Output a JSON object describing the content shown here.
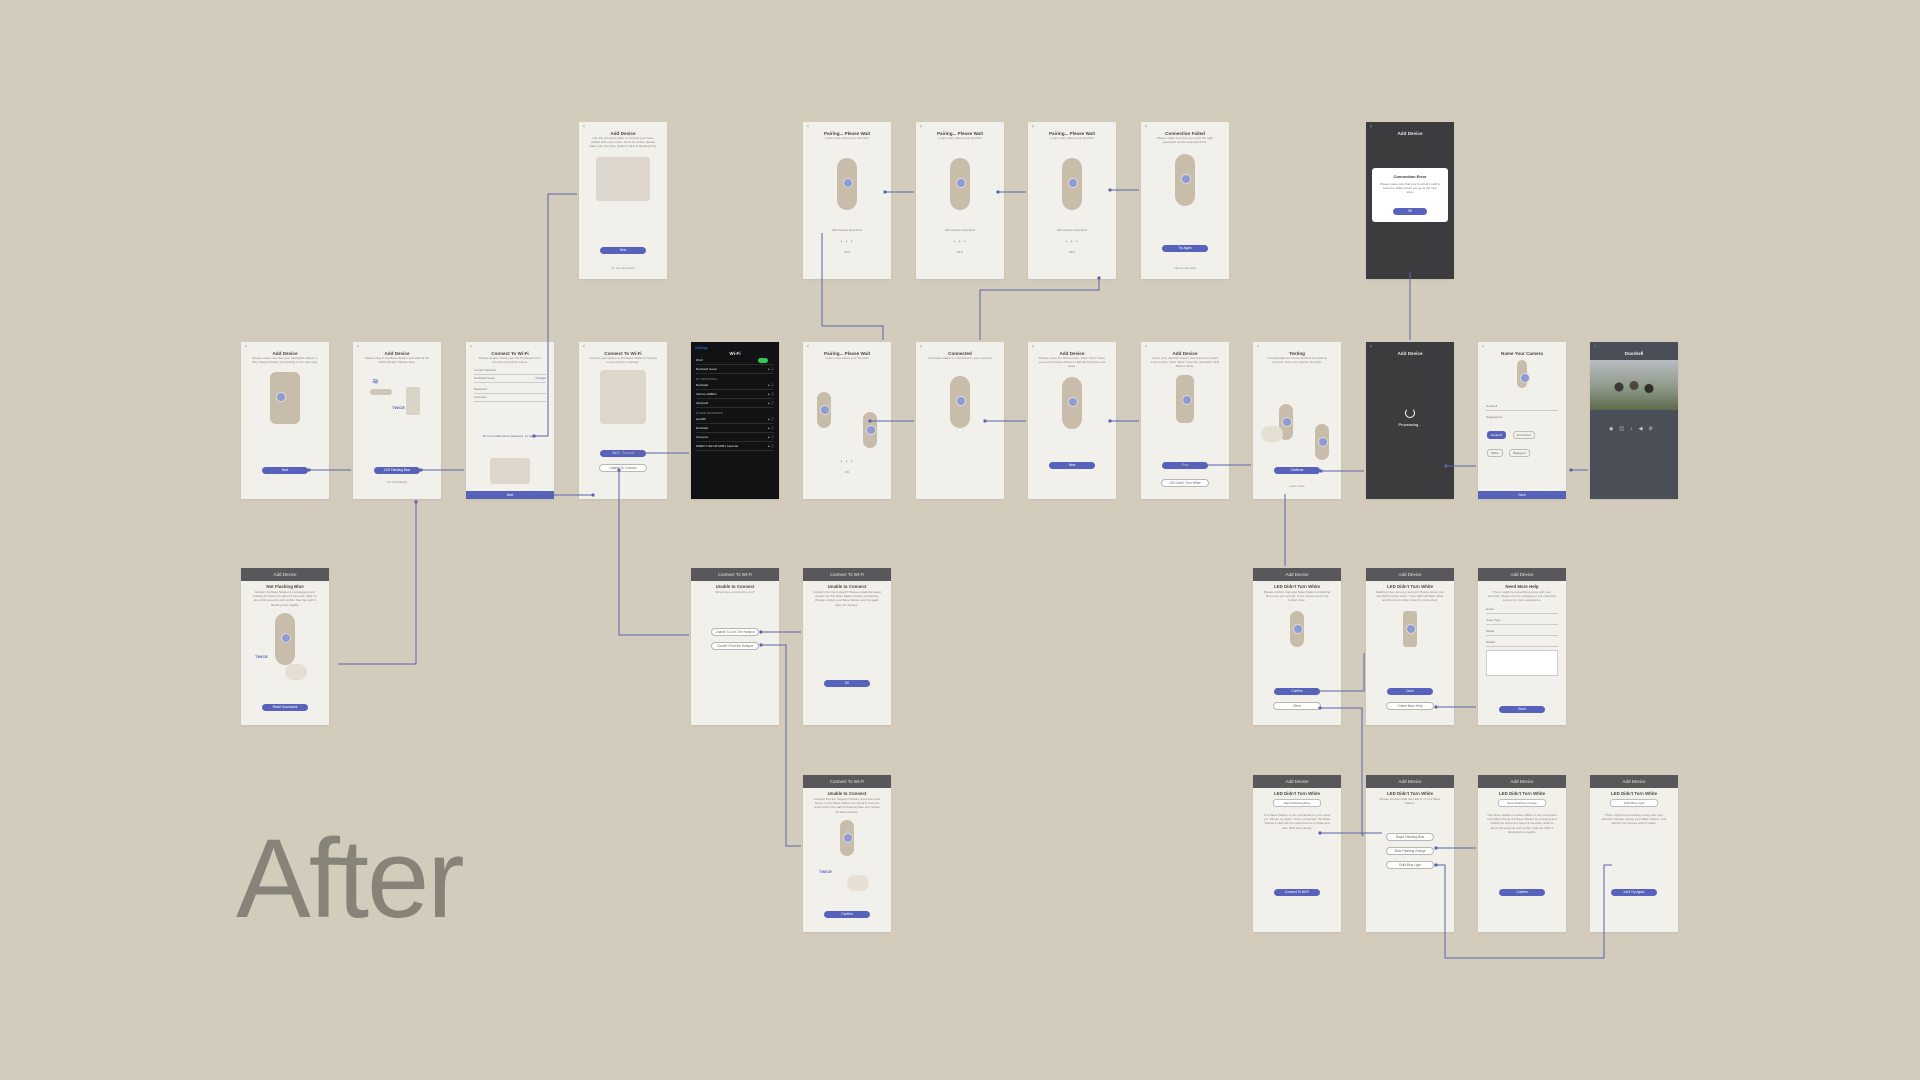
{
  "title": "After",
  "screens": {
    "s_adddevice_top": {
      "title": "Add Device",
      "body": "Use the provided cable to connect your base station with your router. Once it's ready, please make sure the base station's LED is flashing blue.",
      "button": "Next",
      "link": "I'm not connected"
    },
    "s_pair1": {
      "title": "Pairing... Please Wait",
      "body": "Learn more about your doorbell",
      "status": "LED flashes blue/white",
      "pct": "33%"
    },
    "s_pair2": {
      "title": "Pairing... Please Wait",
      "body": "Learn more about your doorbell",
      "status": "LED flashes blue/white",
      "pct": "66%"
    },
    "s_pair3": {
      "title": "Pairing... Please Wait",
      "body": "Learn more about your doorbell",
      "status": "LED flashes blue/white",
      "pct": "99%"
    },
    "s_connfailed": {
      "title": "Connection Failed",
      "body": "Please make sure that you input the right password for the selected Wi-Fi.",
      "button": "Try Again",
      "link": "Need more help"
    },
    "s_connerror": {
      "title": "Add Device",
      "modal_title": "Connection Error",
      "modal_body": "Please make sure that your doorbell's LED is turned to white before you go to the next step.",
      "modal_button": "OK"
    },
    "s_add1": {
      "title": "Add Device",
      "body": "Please make sure that your doorbell's battery is fully charged before proceeding to the next step.",
      "button": "Next"
    },
    "s_add2": {
      "title": "Add Device",
      "body": "Please plug in the Base Station and wait till the LED indicator flashes blue.",
      "button": "LED Flashing Blue",
      "link": "It's not flashing",
      "twice": "TWICE"
    },
    "s_wifi1": {
      "title": "Connect To Wi-Fi",
      "body": "Please double check your Wi-Fi password for smooth connection below.",
      "network_label": "Current Network",
      "network": "Rockwell Guest",
      "change": "Change",
      "password_label": "Password",
      "password": "Unknown",
      "link": "Do not enable Wi-Fi password, try again.",
      "button": "Next"
    },
    "s_wifi2": {
      "title": "Connect To Wi-Fi",
      "body": "Connect your phone to the Base Station's hotspot in your phone's settings.",
      "button": "Go To Connect",
      "button2": "Unable To Connect"
    },
    "s_settings": {
      "title": "Wi-Fi",
      "back": "Settings",
      "wifi_label": "Wi-Fi",
      "current": "Rockwell Guest",
      "section_networks": "MY NETWORKS",
      "networks": [
        "Rockwell",
        "Verizon-GIBDG",
        "xfinitywifi"
      ],
      "section_other": "OTHER NETWORKS",
      "others": [
        "eesWifi",
        "Rockwell",
        "Cameron",
        "DIRECT-4W-HP M281 LaserJet"
      ]
    },
    "s_pair4": {
      "title": "Pairing... Please Wait",
      "body": "Learn more about your doorbell",
      "pct": "0%"
    },
    "s_connected": {
      "title": "Connected",
      "body": "Your base station is connected to your network."
    },
    "s_add3": {
      "title": "Add Device",
      "body": "Please press the button once. Click \"Next\" when you see the base station's LED flashing blue and white.",
      "button": "Next"
    },
    "s_add4": {
      "title": "Add Device",
      "body": "Insert your doorbell battery and press the install button twice. Click \"Next\" once the doorbell's LED flashes white.",
      "button": "Next",
      "button2": "LED Didn't Turn White"
    },
    "s_testing": {
      "title": "Testing",
      "body": "Congratulations! You've finished the pairing process. Now, let's test the doorbell.",
      "button": "Continue",
      "link": "Learn more"
    },
    "s_processing": {
      "title": "Add Device",
      "processing": "Processing..."
    },
    "s_name": {
      "title": "Name Your Camera",
      "field": "Doorbell",
      "suggestions": "Suggestions",
      "chips": [
        "Doorbell",
        "Front Door",
        "Office",
        "Backyard"
      ],
      "button": "Save"
    },
    "s_doorbell": {
      "title": "Doorbell"
    },
    "s_notflashing": {
      "header": "Add Device",
      "title": "Not Flashing Blue",
      "body": "Restart the Base Station by unplugging and holding its button for about 5 seconds. Wait for about 30 seconds and confirm that the LED is flashing blue rapidly.",
      "twice": "TWICE",
      "button": "Reset Successful"
    },
    "s_unable1": {
      "header": "Connect To Wi-Fi",
      "title": "Unable to Connect",
      "body": "What issue occurred to you?",
      "opt1": "Unable To Join The Hotspot",
      "opt2": "Couldn't Find the Hotspot"
    },
    "s_unable2": {
      "header": "Connect To Wi-Fi",
      "title": "Unable to Connect",
      "body": "Couldn't find the hotspot? Please install the latest version on this Base Station before continuing. Please unplug your Base Station and try again after 10 minutes.",
      "button": "OK"
    },
    "s_unable3": {
      "header": "Connect To Wi-Fi",
      "title": "Unable to Connect",
      "body": "Couldn't find the hotspot? Please press the reset button on the Base Station for about 5 seconds and confirm the LED is flashing blue and restart the Base Station.",
      "twice": "TWICE",
      "button": "Confirm"
    },
    "s_led1": {
      "header": "Add Device",
      "title": "LED Didn't Turn White",
      "body": "Please confirm that your Base Station is flashing blue once per second. If not, please press the button once.",
      "button": "Confirm",
      "button2": "Other"
    },
    "s_led2": {
      "header": "Add Device",
      "title": "LED Didn't Turn White",
      "body": "Flashing blue once per second. Please press your doorbell's button twice. Then LED will flash white and then turn white when it's connected.",
      "button": "Done",
      "button2": "I Need More Help"
    },
    "s_help": {
      "header": "Add Device",
      "title": "Need More Help",
      "body": "There might be something wrong with your doorbell. Please send a message to our customer service for more assistance.",
      "fields": [
        "Email",
        "Issue Type",
        "Model",
        "Details"
      ],
      "button": "Send"
    },
    "s_led3": {
      "header": "Add Device",
      "title": "LED Didn't Turn White",
      "dropdown": "Rapid Flashing Blue",
      "body": "Your Base Station is not connected to your router yet. Please try again. Once connected, the Base Station's LED will turn solid blue for a while and then flash blue slowly.",
      "button": "Connect To Wi-Fi"
    },
    "s_led4": {
      "header": "Add Device",
      "title": "LED Didn't Turn White",
      "body": "Please choose what the LED is of your Base Station.",
      "opts": [
        "Rapid Flashing Blue",
        "Slow Flashing Orange",
        "Solid Blue Light"
      ]
    },
    "s_led5": {
      "header": "Add Device",
      "title": "LED Didn't Turn White",
      "dropdown": "Slow Flashing Orange",
      "body": "Your Base Station is either offline or the connection has failed. Reset the Base Station by pressing and holding its button for about 5 seconds. Wait for about 30 seconds and confirm that the LED is flashing blue rapidly.",
      "button": "Confirm"
    },
    "s_led6": {
      "header": "Add Device",
      "title": "LED Didn't Turn White",
      "dropdown": "Solid Blue Light",
      "body": "There might be something wrong with your doorbell. Please unplug your Base Station, and wait for 10 minutes and try again.",
      "button": "Let's Try Again"
    }
  },
  "colors": {
    "background": "#d3ccbd",
    "screen": "#f2f0eb",
    "accent": "#5762ba",
    "dark": "#3c3c3e"
  }
}
